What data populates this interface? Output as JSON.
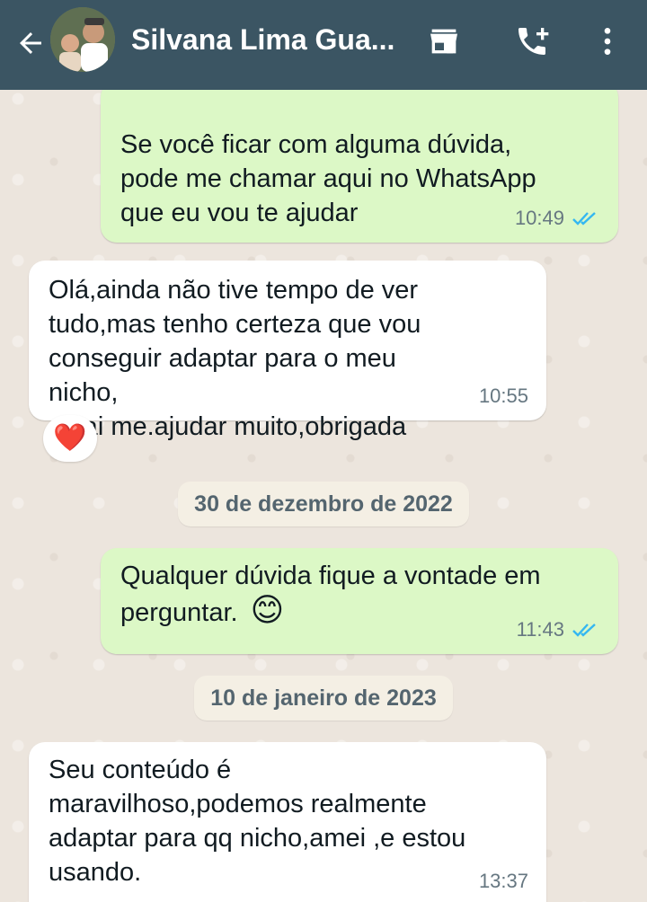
{
  "header": {
    "contact_name": "Silvana Lima Gua...",
    "icons": [
      "back-arrow-icon",
      "storefront-icon",
      "add-call-icon",
      "more-vert-icon"
    ],
    "bar_color": "#3b5563"
  },
  "messages": [
    {
      "direction": "out",
      "text": "Se você ficar com alguma dúvida,\npode me chamar aqui no WhatsApp\nque eu vou te ajudar",
      "time": "10:49",
      "read": true
    },
    {
      "direction": "in",
      "text": "Olá,ainda não tive tempo de ver\ntudo,mas tenho certeza que vou\nconseguir adaptar para o meu nicho,\ne vai me.ajudar muito,obrigada",
      "time": "10:55",
      "reaction": "❤️"
    },
    {
      "direction": "out",
      "text": "Qualquer dúvida fique a vontade em\nperguntar.",
      "emoji": "😊",
      "time": "11:43",
      "read": true
    },
    {
      "direction": "in",
      "text": "Seu conteúdo é\nmaravilhoso,podemos realmente\nadaptar para qq nicho,amei ,e estou\nusando.",
      "time": "13:37"
    }
  ],
  "date_separators": [
    "30 de dezembro de 2022",
    "10 de janeiro de 2023"
  ],
  "colors": {
    "outgoing_bubble": "#dcf8c6",
    "incoming_bubble": "#ffffff",
    "read_ticks": "#34b7f1"
  }
}
